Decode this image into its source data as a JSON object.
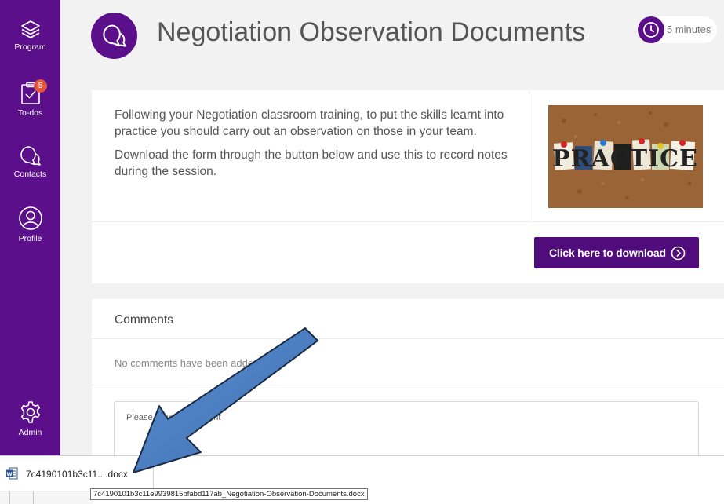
{
  "sidebar": {
    "items": [
      {
        "label": "Program",
        "icon": "layers-icon"
      },
      {
        "label": "To-dos",
        "icon": "clipboard-check-icon",
        "badge": "5"
      },
      {
        "label": "Contacts",
        "icon": "chat-bubbles-icon"
      },
      {
        "label": "Profile",
        "icon": "user-icon"
      }
    ],
    "admin": {
      "label": "Admin",
      "icon": "gear-icon"
    }
  },
  "header": {
    "title": "Negotiation Observation Documents",
    "duration": "5 minutes",
    "icon": "chat-bubbles-icon"
  },
  "intro": {
    "paragraph1": "Following your Negotiation classroom training, to put the skills learnt into practice you should carry out an observation on those in your team.",
    "paragraph2": "Download the form through the button below and use this to record notes during the session.",
    "image_text": "PRACTICE"
  },
  "download_button": {
    "label": "Click here to download"
  },
  "comments": {
    "title": "Comments",
    "empty_text": "No comments have been added",
    "placeholder": "Please leave a comment"
  },
  "downloads_bar": {
    "file_name": "7c4190101b3c11....docx",
    "tooltip": "7c4190101b3c11e9939815bfabd117ab_Negotiation-Observation-Documents.docx"
  },
  "colors": {
    "brand_purple": "#5b0f8a",
    "button_purple": "#4f0c7a",
    "badge_orange": "#e0573d",
    "arrow_blue": "#4f81bd"
  }
}
